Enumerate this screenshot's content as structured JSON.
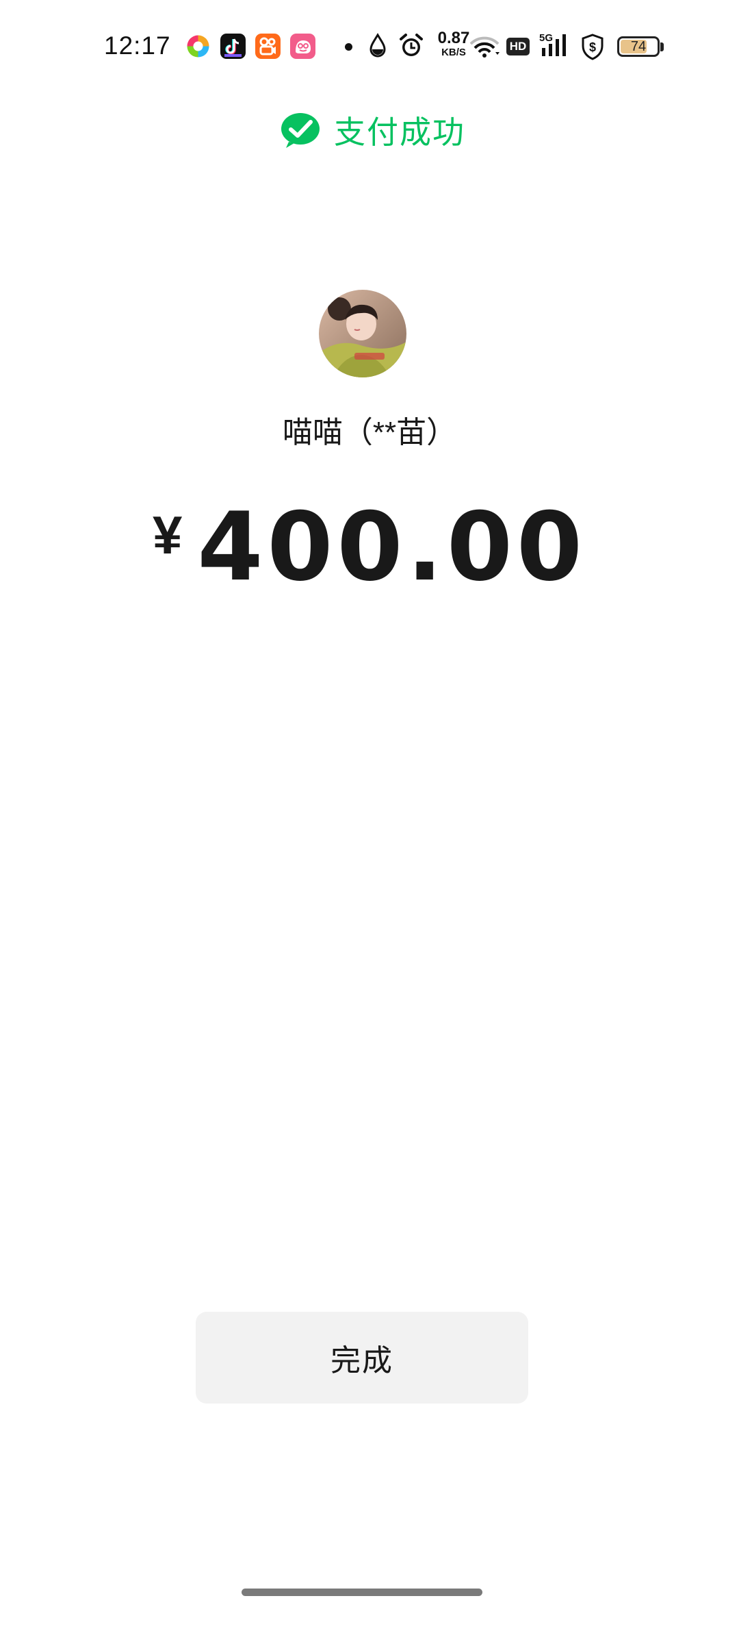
{
  "status_bar": {
    "time": "12:17",
    "apps": [
      "colorful-pinwheel-app-icon",
      "tiktok-icon",
      "kuaishou-icon",
      "pink-face-app-icon"
    ],
    "net_speed_value": "0.87",
    "net_speed_unit": "KB/S",
    "hd_label": "HD",
    "network_label": "5G",
    "battery_level": "74",
    "battery_fill_fraction": 0.74
  },
  "header": {
    "title": "支付成功",
    "accent_color": "#07c160"
  },
  "recipient": {
    "name": "喵喵（**苗）"
  },
  "payment": {
    "currency": "¥",
    "amount": "400.00"
  },
  "actions": {
    "done_label": "完成"
  }
}
